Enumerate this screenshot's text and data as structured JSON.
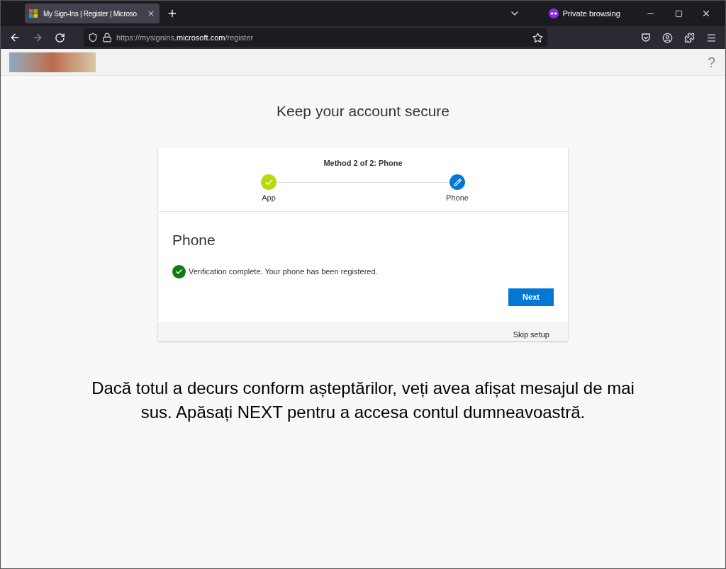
{
  "browser": {
    "tab": {
      "title": "My Sign-Ins | Register | Microso",
      "selected": true
    },
    "url": "https://mysignins.**microsoft.com**/register",
    "private_label": "Private browsing"
  },
  "header": {
    "help": "?"
  },
  "page": {
    "title": "Keep your account secure",
    "card": {
      "method": "Method 2 of 2: Phone",
      "steps": [
        {
          "label": "App",
          "done": true
        },
        {
          "label": "Phone",
          "done": false
        }
      ],
      "heading": "Phone",
      "message": "Verification complete. Your phone has been registered.",
      "next_button": "Next",
      "skip_link": "Skip setup"
    },
    "caption": "Dacă totul a decurs conform așteptărilor, veți avea afișat mesajul de mai sus. Apăsați NEXT pentru a accesa contul dumneavoastră."
  }
}
